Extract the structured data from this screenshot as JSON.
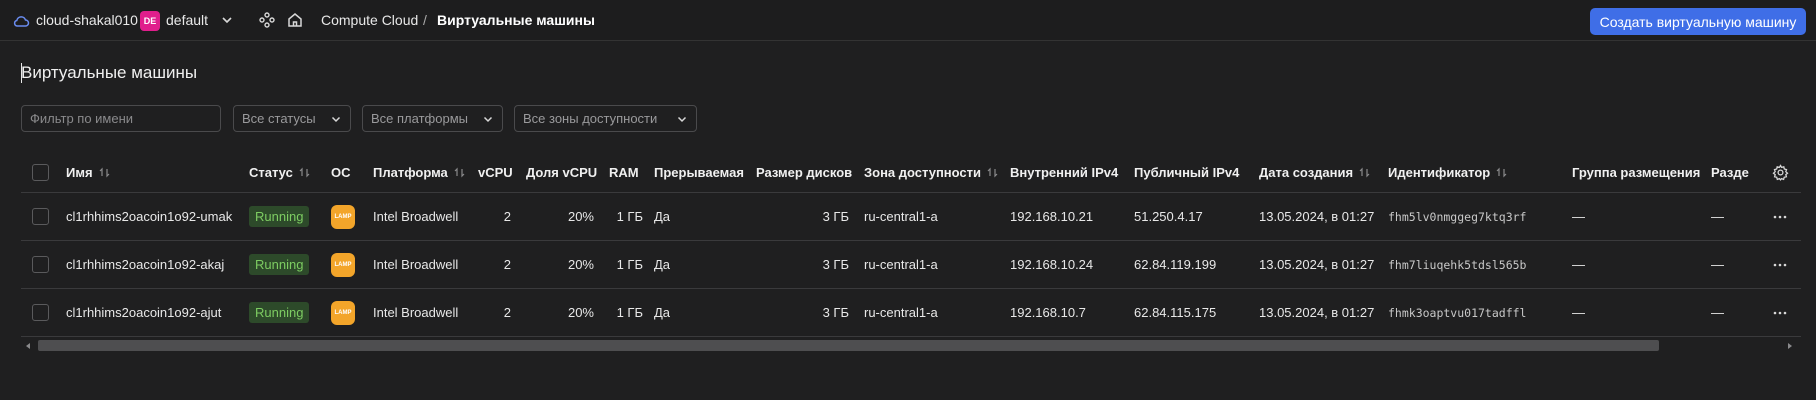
{
  "topbar": {
    "cloud_name": "cloud-shakal010",
    "folder_badge": "DE",
    "folder_name": "default",
    "breadcrumb": [
      "Compute Cloud",
      "Виртуальные машины"
    ],
    "breadcrumb_separator": "/",
    "create_button": "Создать виртуальную машину",
    "accent_color": "#3f6ee7",
    "badge_color": "#e01e8c"
  },
  "page": {
    "title": "Виртуальные машины"
  },
  "filters": {
    "name_placeholder": "Фильтр по имени",
    "status_select": "Все статусы",
    "platform_select": "Все платформы",
    "zone_select": "Все зоны доступности"
  },
  "table": {
    "columns": [
      "Имя",
      "Статус",
      "ОС",
      "Платформа",
      "vCPU",
      "Доля vCPU",
      "RAM",
      "Прерываемая",
      "Размер дисков",
      "Зона доступности",
      "Внутренний IPv4",
      "Публичный IPv4",
      "Дата создания",
      "Идентификатор",
      "Группа размещения",
      "Разде"
    ],
    "rows": [
      {
        "name": "cl1rhhims2oacoin1o92-umak",
        "status": "Running",
        "os": "LAMP",
        "platform": "Intel Broadwell",
        "vcpu": "2",
        "vcpu_share": "20%",
        "ram": "1 ГБ",
        "preemptible": "Да",
        "disk_size": "3 ГБ",
        "zone": "ru-central1-a",
        "internal_ip": "192.168.10.21",
        "public_ip": "51.250.4.17",
        "created": "13.05.2024, в 01:27",
        "id": "fhm5lv0nmggeg7ktq3rf",
        "placement_group": "—",
        "partition": "—"
      },
      {
        "name": "cl1rhhims2oacoin1o92-akaj",
        "status": "Running",
        "os": "LAMP",
        "platform": "Intel Broadwell",
        "vcpu": "2",
        "vcpu_share": "20%",
        "ram": "1 ГБ",
        "preemptible": "Да",
        "disk_size": "3 ГБ",
        "zone": "ru-central1-a",
        "internal_ip": "192.168.10.24",
        "public_ip": "62.84.119.199",
        "created": "13.05.2024, в 01:27",
        "id": "fhm7liuqehk5tdsl565b",
        "placement_group": "—",
        "partition": "—"
      },
      {
        "name": "cl1rhhims2oacoin1o92-ajut",
        "status": "Running",
        "os": "LAMP",
        "platform": "Intel Broadwell",
        "vcpu": "2",
        "vcpu_share": "20%",
        "ram": "1 ГБ",
        "preemptible": "Да",
        "disk_size": "3 ГБ",
        "zone": "ru-central1-a",
        "internal_ip": "192.168.10.7",
        "public_ip": "62.84.115.175",
        "created": "13.05.2024, в 01:27",
        "id": "fhmk3oaptvu017tadffl",
        "placement_group": "—",
        "partition": "—"
      }
    ],
    "status_color": "#7dcc62"
  }
}
